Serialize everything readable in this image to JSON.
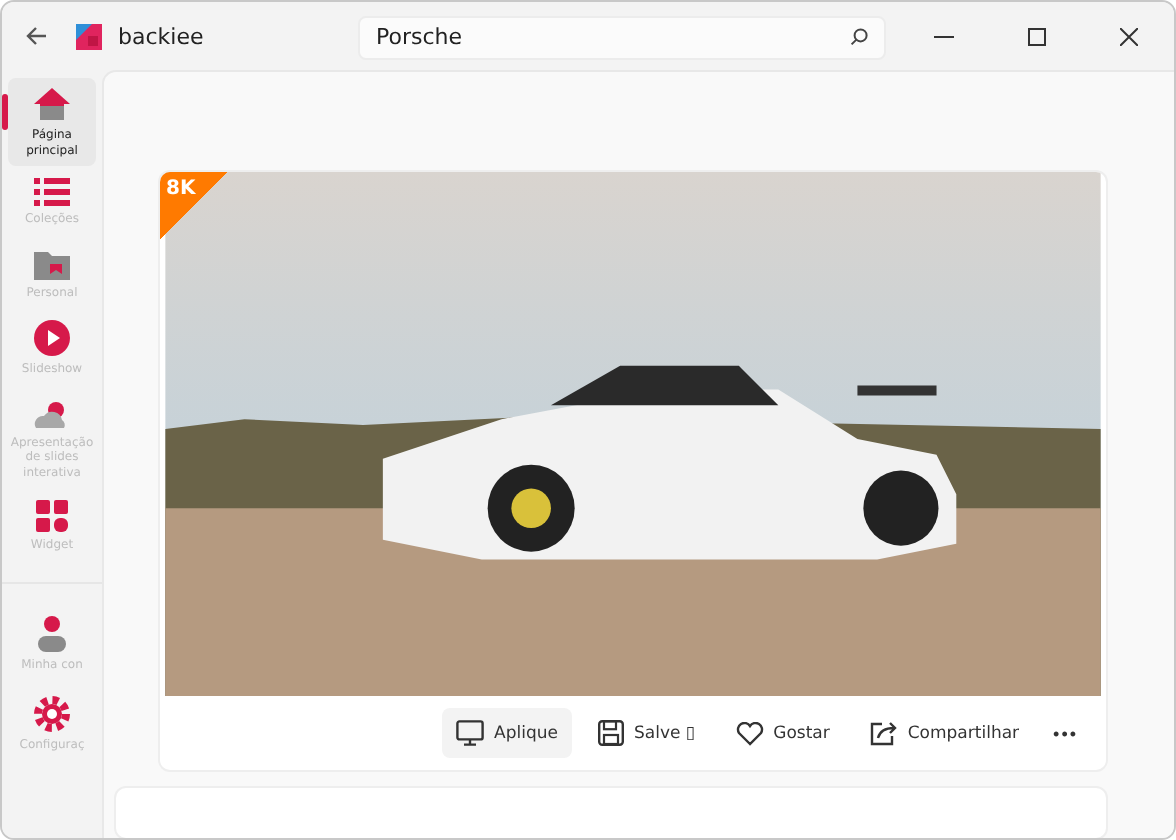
{
  "titlebar": {
    "app_name": "backiee",
    "search": {
      "value": "Porsche"
    }
  },
  "sidebar": {
    "items": [
      {
        "label": "Página principal",
        "selected": true
      },
      {
        "label": "Coleções",
        "selected": false
      },
      {
        "label": "Personal",
        "selected": false
      },
      {
        "label": "Slideshow",
        "selected": false
      },
      {
        "label": "Apresentação de slides interativa",
        "selected": false
      },
      {
        "label": "Widget",
        "selected": false
      }
    ],
    "footer_items": [
      {
        "label": "Minha con",
        "selected": false
      },
      {
        "label": "Configuraç",
        "selected": false
      }
    ]
  },
  "wallpaper": {
    "badge": "8K"
  },
  "actions": [
    {
      "label": "Aplique",
      "selected": true
    },
    {
      "label": "Salve ▯",
      "selected": false
    },
    {
      "label": "Gostar",
      "selected": false
    },
    {
      "label": "Compartilhar",
      "selected": false
    }
  ],
  "more": "•••"
}
